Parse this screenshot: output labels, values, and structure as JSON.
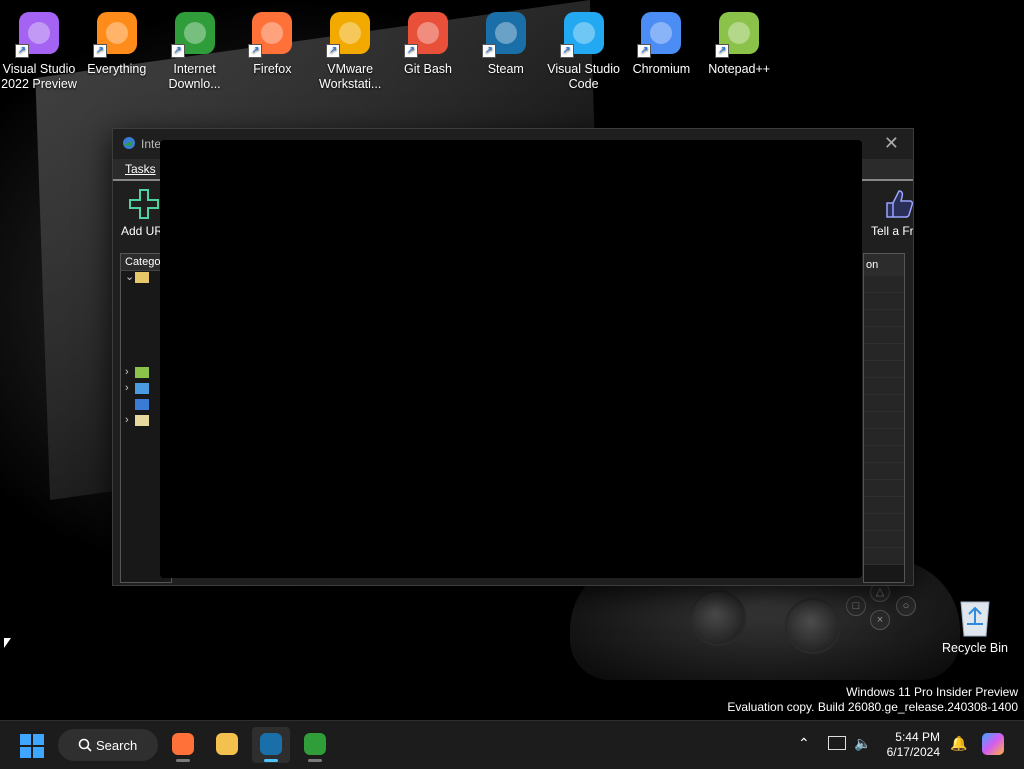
{
  "desktop": {
    "icons": [
      {
        "id": "vs2022",
        "label": "Visual Studio 2022 Preview",
        "icon": "visual-studio-preview-icon",
        "color": "#a463f2"
      },
      {
        "id": "everything",
        "label": "Everything",
        "icon": "magnifier-icon",
        "color": "#ff8c1a"
      },
      {
        "id": "idm",
        "label": "Internet Downlo...",
        "icon": "internet-download-manager-icon",
        "color": "#2e9d3a"
      },
      {
        "id": "firefox",
        "label": "Firefox",
        "icon": "firefox-icon",
        "color": "#ff7139"
      },
      {
        "id": "vmware",
        "label": "VMware Workstati...",
        "icon": "vmware-icon",
        "color": "#f2a900"
      },
      {
        "id": "gitbash",
        "label": "Git Bash",
        "icon": "git-bash-icon",
        "color": "#e8503a"
      },
      {
        "id": "steam",
        "label": "Steam",
        "icon": "steam-icon",
        "color": "#1b6fa8"
      },
      {
        "id": "vscode",
        "label": "Visual Studio Code",
        "icon": "vscode-icon",
        "color": "#23a9f2"
      },
      {
        "id": "chromium",
        "label": "Chromium",
        "icon": "chromium-icon",
        "color": "#4b8cf5"
      },
      {
        "id": "notepadpp",
        "label": "Notepad++",
        "icon": "notepad-plus-plus-icon",
        "color": "#8bc34a"
      }
    ],
    "recycle_bin": {
      "label": "Recycle Bin",
      "icon": "recycle-bin-icon"
    }
  },
  "idm_window": {
    "title": "Inte",
    "menu": {
      "tasks": "Tasks"
    },
    "toolbar": {
      "add_url": "Add UR",
      "tell_friend": "Tell a Fr"
    },
    "categories_header": "Catego",
    "list_header": "on"
  },
  "watermark": {
    "line1": "Windows 11 Pro Insider Preview",
    "line2": "Evaluation copy. Build 26080.ge_release.240308-1400"
  },
  "taskbar": {
    "search_label": "Search",
    "apps": [
      {
        "id": "firefox",
        "icon": "firefox-icon",
        "active": false
      },
      {
        "id": "explorer",
        "icon": "file-explorer-icon",
        "active": false
      },
      {
        "id": "steam",
        "icon": "steam-icon",
        "active": true
      },
      {
        "id": "idm",
        "icon": "internet-download-manager-icon",
        "active": false
      }
    ],
    "time": "5:44 PM",
    "date": "6/17/2024"
  }
}
